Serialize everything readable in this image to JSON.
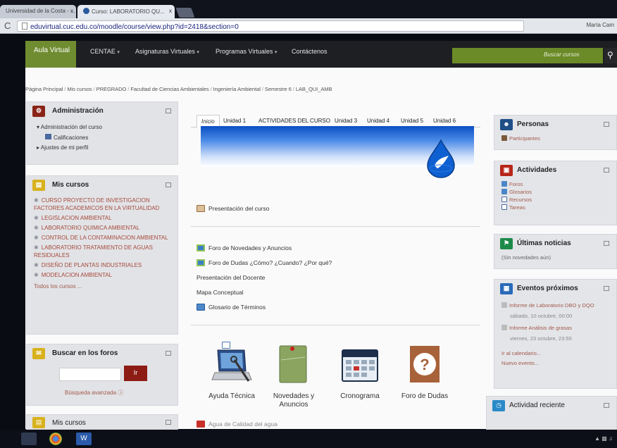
{
  "browser": {
    "tabs": [
      {
        "title": "Universidad de la Costa - ...",
        "close": "x"
      },
      {
        "title": "Curso: LABORATORIO QU...",
        "close": "x"
      }
    ],
    "url": "eduvirtual.cuc.edu.co/moodle/course/view.php?id=2418&section=0",
    "user": "María Cam"
  },
  "nav": {
    "brand": "Aula Virtual",
    "items": [
      {
        "label": "CENTAE",
        "caret": "▾"
      },
      {
        "label": "Asignaturas Virtuales",
        "caret": "▾"
      },
      {
        "label": "Programas Virtuales",
        "caret": "▾"
      },
      {
        "label": "Contáctenos",
        "caret": ""
      }
    ],
    "search_placeholder": "Buscar cursos",
    "search_icon": "magnifier-icon"
  },
  "breadcrumb": [
    "Página Principal",
    "Mis cursos",
    "PREGRADO",
    "Facultad de Ciencias Ambientales",
    "Ingeniería Ambiental",
    "Semestre 6",
    "LAB_QUI_AMB"
  ],
  "admin": {
    "title": "Administración",
    "course_admin": "Administración del curso",
    "grades": "Calificaciones",
    "profile": "Ajustes de mi perfil"
  },
  "mis_cursos": {
    "title": "Mis cursos",
    "courses": [
      "CURSO PROYECTO DE INVESTIGACION FACTORES ACADEMICOS EN LA VIRTUALIDAD",
      "LEGISLACION AMBIENTAL",
      "LABORATORIO QUIMICA AMBIENTAL",
      "CONTROL DE LA CONTAMINACION AMBIENTAL",
      "LABORATORIO TRATAMIENTO DE AGUAS RESIDUALES",
      "DISEÑO DE PLANTAS INDUSTRIALES",
      "MODELACION AMBIENTAL"
    ],
    "all": "Todos los cursos ..."
  },
  "foros": {
    "title": "Buscar en los foros",
    "button": "Ir",
    "advanced": "Búsqueda avanzada"
  },
  "mis_cursos2": {
    "title": "Mis cursos"
  },
  "course": {
    "tabs": [
      "Inicio",
      "Unidad 1",
      "ACTIVIDADES DEL CURSO",
      "Unidad 3",
      "Unidad 4",
      "Unidad 5",
      "Unidad 6"
    ],
    "presentation": "Presentación del curso",
    "activities": [
      {
        "label": "Foro de Novedades y Anuncios",
        "icon": "forum"
      },
      {
        "label": "Foro de Dudas ¿Cómo? ¿Cuando? ¿Por qué?",
        "icon": "forum"
      },
      {
        "label": "Presentación del Docente",
        "icon": "page"
      },
      {
        "label": "Mapa Conceptual",
        "icon": "page"
      },
      {
        "label": "Glosario de Términos",
        "icon": "glos"
      }
    ],
    "tiles": [
      {
        "label": "Ayuda Técnica"
      },
      {
        "label": "Novedades y Anuncios",
        "note": "Anuncios"
      },
      {
        "label": "Cronograma"
      },
      {
        "label": "Foro de Dudas",
        "glyph": "?"
      }
    ],
    "cut_item": "Agua de Calidad del agua"
  },
  "personas": {
    "title": "Personas",
    "participants": "Participantes"
  },
  "actividades": {
    "title": "Actividades",
    "items": [
      "Foros",
      "Glosarios",
      "Recursos",
      "Tareas"
    ]
  },
  "noticias": {
    "title": "Últimas noticias",
    "empty": "(Sin novedades aún)"
  },
  "eventos": {
    "title": "Eventos próximos",
    "events": [
      {
        "name": "Informe de Laboratorio DBO y DQO",
        "date": "sábado, 10 octubre, 00:00"
      },
      {
        "name": "Informe Análisis de grasas",
        "date": "viernes, 23 octubre, 23:55"
      }
    ],
    "calendar": "Ir al calendario...",
    "new_event": "Nuevo evento..."
  },
  "reciente": {
    "title": "Actividad reciente"
  }
}
